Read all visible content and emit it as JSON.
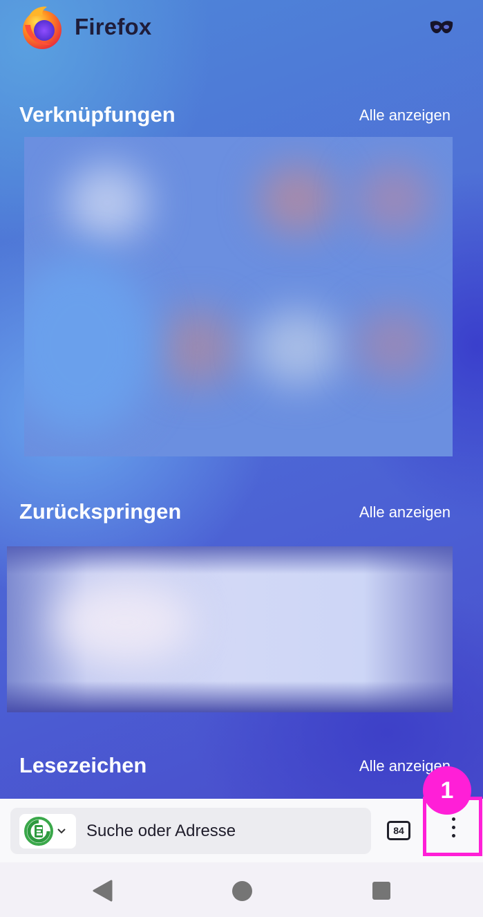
{
  "brand": {
    "name": "Firefox",
    "logo_icon": "firefox-logo-icon",
    "private_icon": "private-mask-icon"
  },
  "sections": {
    "shortcuts": {
      "title": "Verknüpfungen",
      "see_all": "Alle anzeigen"
    },
    "jump_back_in": {
      "title": "Zurückspringen",
      "see_all": "Alle anzeigen"
    },
    "bookmarks": {
      "title": "Lesezeichen",
      "see_all": "Alle anzeigen"
    }
  },
  "toolbar": {
    "search_engine_icon": "ecosia-icon",
    "search_placeholder": "Suche oder Adresse",
    "tab_count": "84",
    "menu_icon": "three-dots-vertical-icon"
  },
  "annotation": {
    "step_number": "1",
    "color": "#ff1fd7"
  },
  "nav": {
    "back_icon": "back-triangle-icon",
    "home_icon": "home-circle-icon",
    "recents_icon": "recents-square-icon"
  },
  "colors": {
    "toolbar_bg": "#f9f9fb",
    "url_bar_bg": "#ececf0",
    "highlight": "#ff1fd7"
  }
}
